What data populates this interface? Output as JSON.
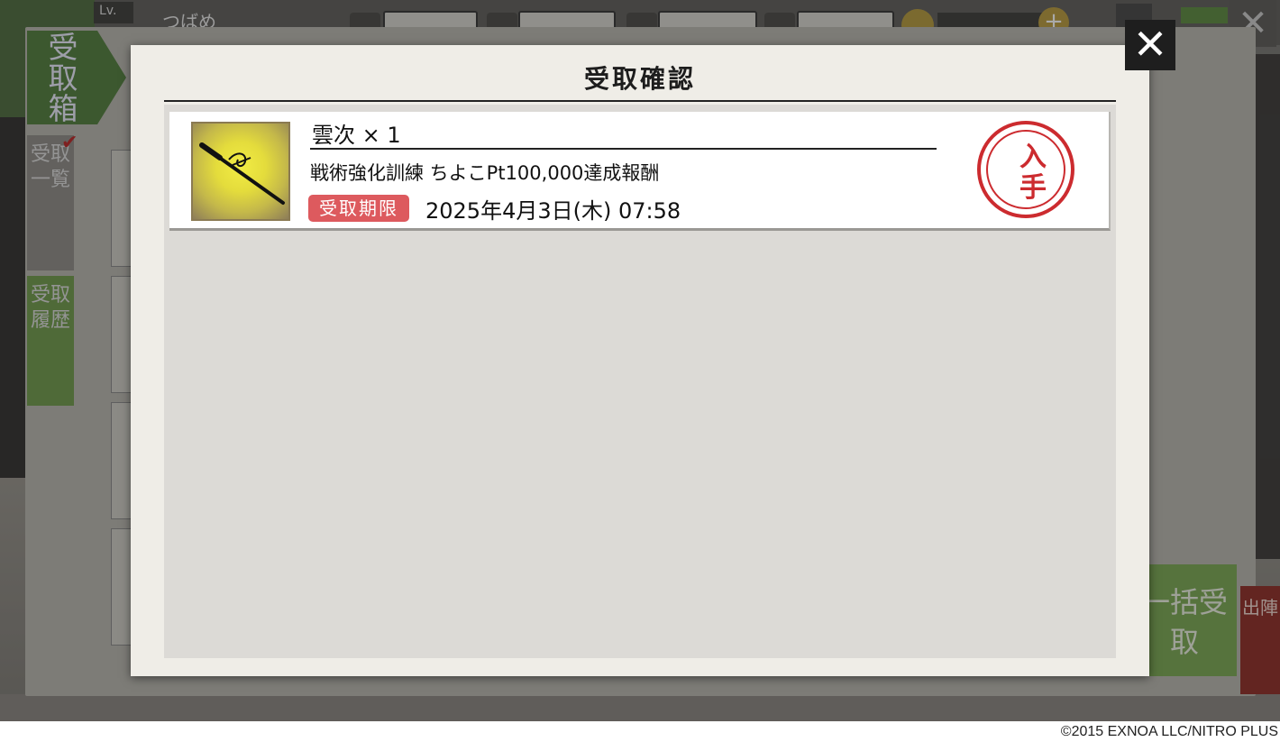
{
  "background": {
    "level_label": "Lv.",
    "player_name": "つばめ",
    "inbox_tab_title": "受取箱",
    "side_tabs": [
      "受取一覧",
      "受取履歴"
    ],
    "bulk_receive_label": "一括受取",
    "sortie_label": "出陣"
  },
  "modal": {
    "title": "受取確認",
    "close_label": "✕",
    "items": [
      {
        "name": "雲次 × 1",
        "description": "戦術強化訓練 ちよこPt100,000達成報酬",
        "deadline_label": "受取期限",
        "deadline_value": "2025年4月3日(木) 07:58",
        "status_stamp": "入手",
        "icon": "sword-icon"
      }
    ]
  },
  "footer": {
    "copyright": "©2015 EXNOA LLC/NITRO PLUS"
  },
  "colors": {
    "modal_bg": "#efede7",
    "list_bg": "#dcdad6",
    "deadline_badge": "#dd5a5e",
    "stamp_red": "#cc2b2f",
    "inbox_green": "#4f7d3b"
  }
}
